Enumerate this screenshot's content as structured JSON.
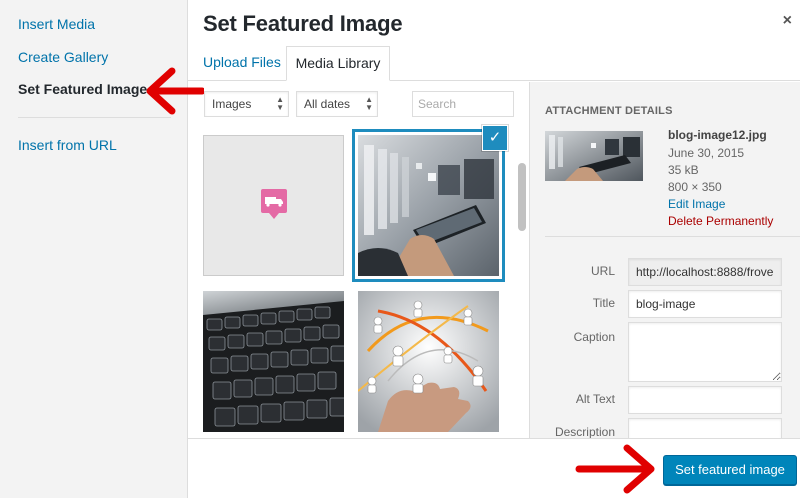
{
  "sidebar": {
    "items": [
      {
        "label": "Insert Media"
      },
      {
        "label": "Create Gallery"
      },
      {
        "label": "Set Featured Image"
      },
      {
        "label": "Insert from URL"
      }
    ]
  },
  "header": {
    "title": "Set Featured Image",
    "close_icon": "×"
  },
  "tabs": [
    {
      "label": "Upload Files"
    },
    {
      "label": "Media Library"
    }
  ],
  "toolbar": {
    "type_filter": "Images",
    "date_filter": "All dates",
    "search_placeholder": "Search"
  },
  "details": {
    "heading": "ATTACHMENT DETAILS",
    "filename": "blog-image12.jpg",
    "date": "June 30, 2015",
    "size": "35 kB",
    "dimensions": "800 × 350",
    "edit_link": "Edit Image",
    "delete_link": "Delete Permanently",
    "fields": {
      "url_label": "URL",
      "url_value": "http://localhost:8888/frove",
      "title_label": "Title",
      "title_value": "blog-image",
      "caption_label": "Caption",
      "alt_label": "Alt Text",
      "description_label": "Description"
    }
  },
  "footer": {
    "button_label": "Set featured image"
  },
  "colors": {
    "accent": "#0085ba",
    "link": "#0073aa",
    "delete": "#aa0000",
    "arrow": "#e00000"
  }
}
